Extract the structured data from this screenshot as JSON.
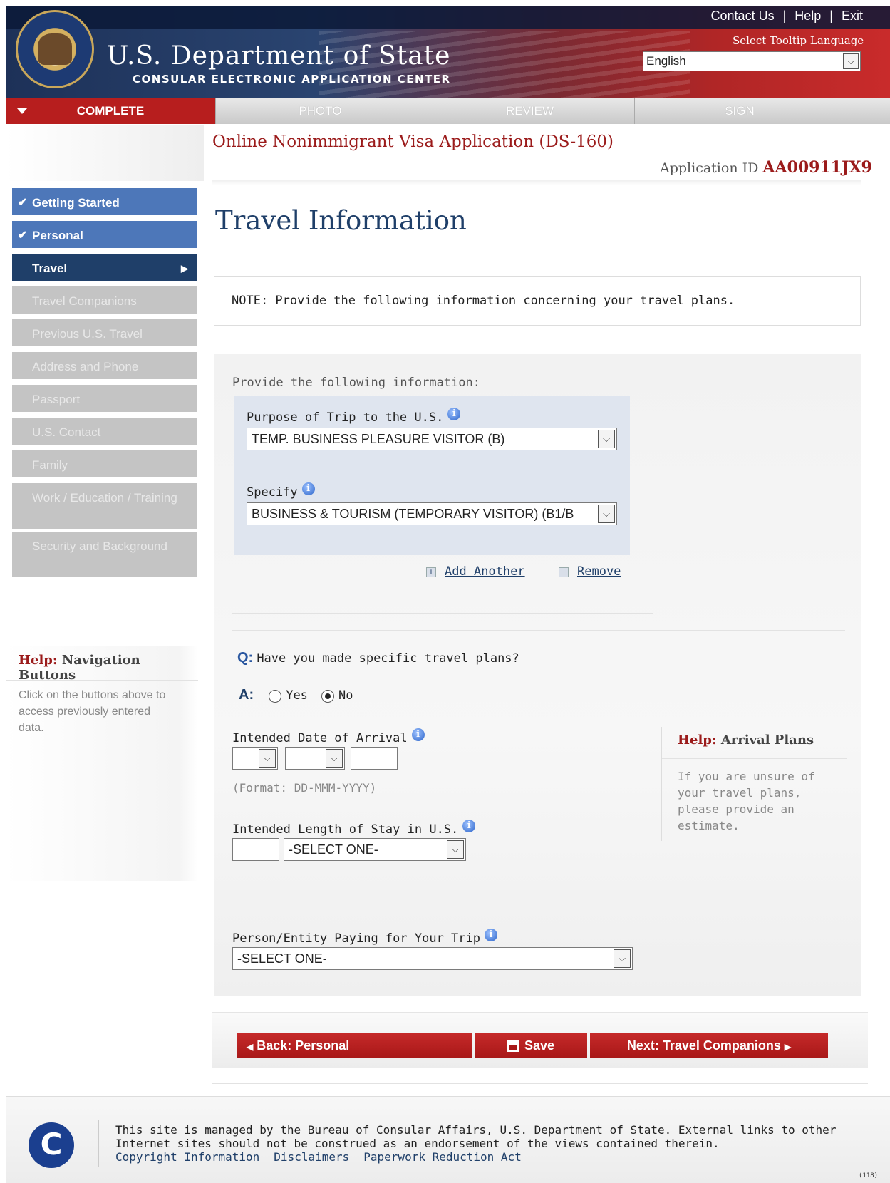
{
  "header": {
    "title": "U.S. Department of State",
    "subtitle": "CONSULAR ELECTRONIC APPLICATION CENTER",
    "links": [
      "Contact Us",
      "Help",
      "Exit"
    ],
    "tooltip_language_label": "Select Tooltip Language",
    "tooltip_language_value": "English"
  },
  "progress_tabs": [
    {
      "label": "COMPLETE",
      "active": true
    },
    {
      "label": "PHOTO",
      "active": false
    },
    {
      "label": "REVIEW",
      "active": false
    },
    {
      "label": "SIGN",
      "active": false
    }
  ],
  "sidebar": {
    "items": [
      {
        "label": "Getting Started",
        "state": "done"
      },
      {
        "label": "Personal",
        "state": "done"
      },
      {
        "label": "Travel",
        "state": "current"
      },
      {
        "label": "Travel Companions",
        "state": "disabled"
      },
      {
        "label": "Previous U.S. Travel",
        "state": "disabled"
      },
      {
        "label": "Address and Phone",
        "state": "disabled"
      },
      {
        "label": "Passport",
        "state": "disabled"
      },
      {
        "label": "U.S. Contact",
        "state": "disabled"
      },
      {
        "label": "Family",
        "state": "disabled"
      },
      {
        "label": "Work / Education / Training",
        "state": "disabled"
      },
      {
        "label": "Security and Background",
        "state": "disabled"
      }
    ],
    "help": {
      "prefix": "Help:",
      "title": "Navigation Buttons",
      "text": "Click on the buttons above to access previously entered data."
    }
  },
  "main": {
    "app_title": "Online Nonimmigrant Visa Application (DS-160)",
    "app_id_label": "Application ID",
    "app_id": "AA00911JX9",
    "page_title": "Travel Information",
    "note": "NOTE: Provide the following information concerning your travel plans.",
    "provide_label": "Provide the following information:",
    "purpose_label": "Purpose of Trip to the U.S.",
    "purpose_value": "TEMP. BUSINESS PLEASURE VISITOR (B)",
    "specify_label": "Specify",
    "specify_value": "BUSINESS & TOURISM (TEMPORARY VISITOR) (B1/B",
    "add_another": "Add Another",
    "remove": "Remove",
    "question_prefix": "Q:",
    "question": "Have you made specific travel plans?",
    "answer_prefix": "A:",
    "answer_yes": "Yes",
    "answer_no": "No",
    "arrival_label": "Intended Date of Arrival",
    "arrival_format": "(Format: DD-MMM-YYYY)",
    "stay_label": "Intended Length of Stay in U.S.",
    "stay_unit_value": "-SELECT ONE-",
    "payer_label": "Person/Entity Paying for Your Trip",
    "payer_value": "-SELECT ONE-",
    "arrival_help_prefix": "Help:",
    "arrival_help_title": "Arrival Plans",
    "arrival_help_text": "If you are unsure of your travel plans, please provide an estimate."
  },
  "buttons": {
    "back": "Back: Personal",
    "save": "Save",
    "next": "Next: Travel Companions"
  },
  "footer": {
    "text": "This site is managed by the Bureau of Consular Affairs, U.S. Department of State. External links to other Internet sites should not be construed as an endorsement of the views contained therein.",
    "links": [
      "Copyright Information",
      "Disclaimers",
      "Paperwork Reduction Act"
    ],
    "version": "(118)"
  }
}
